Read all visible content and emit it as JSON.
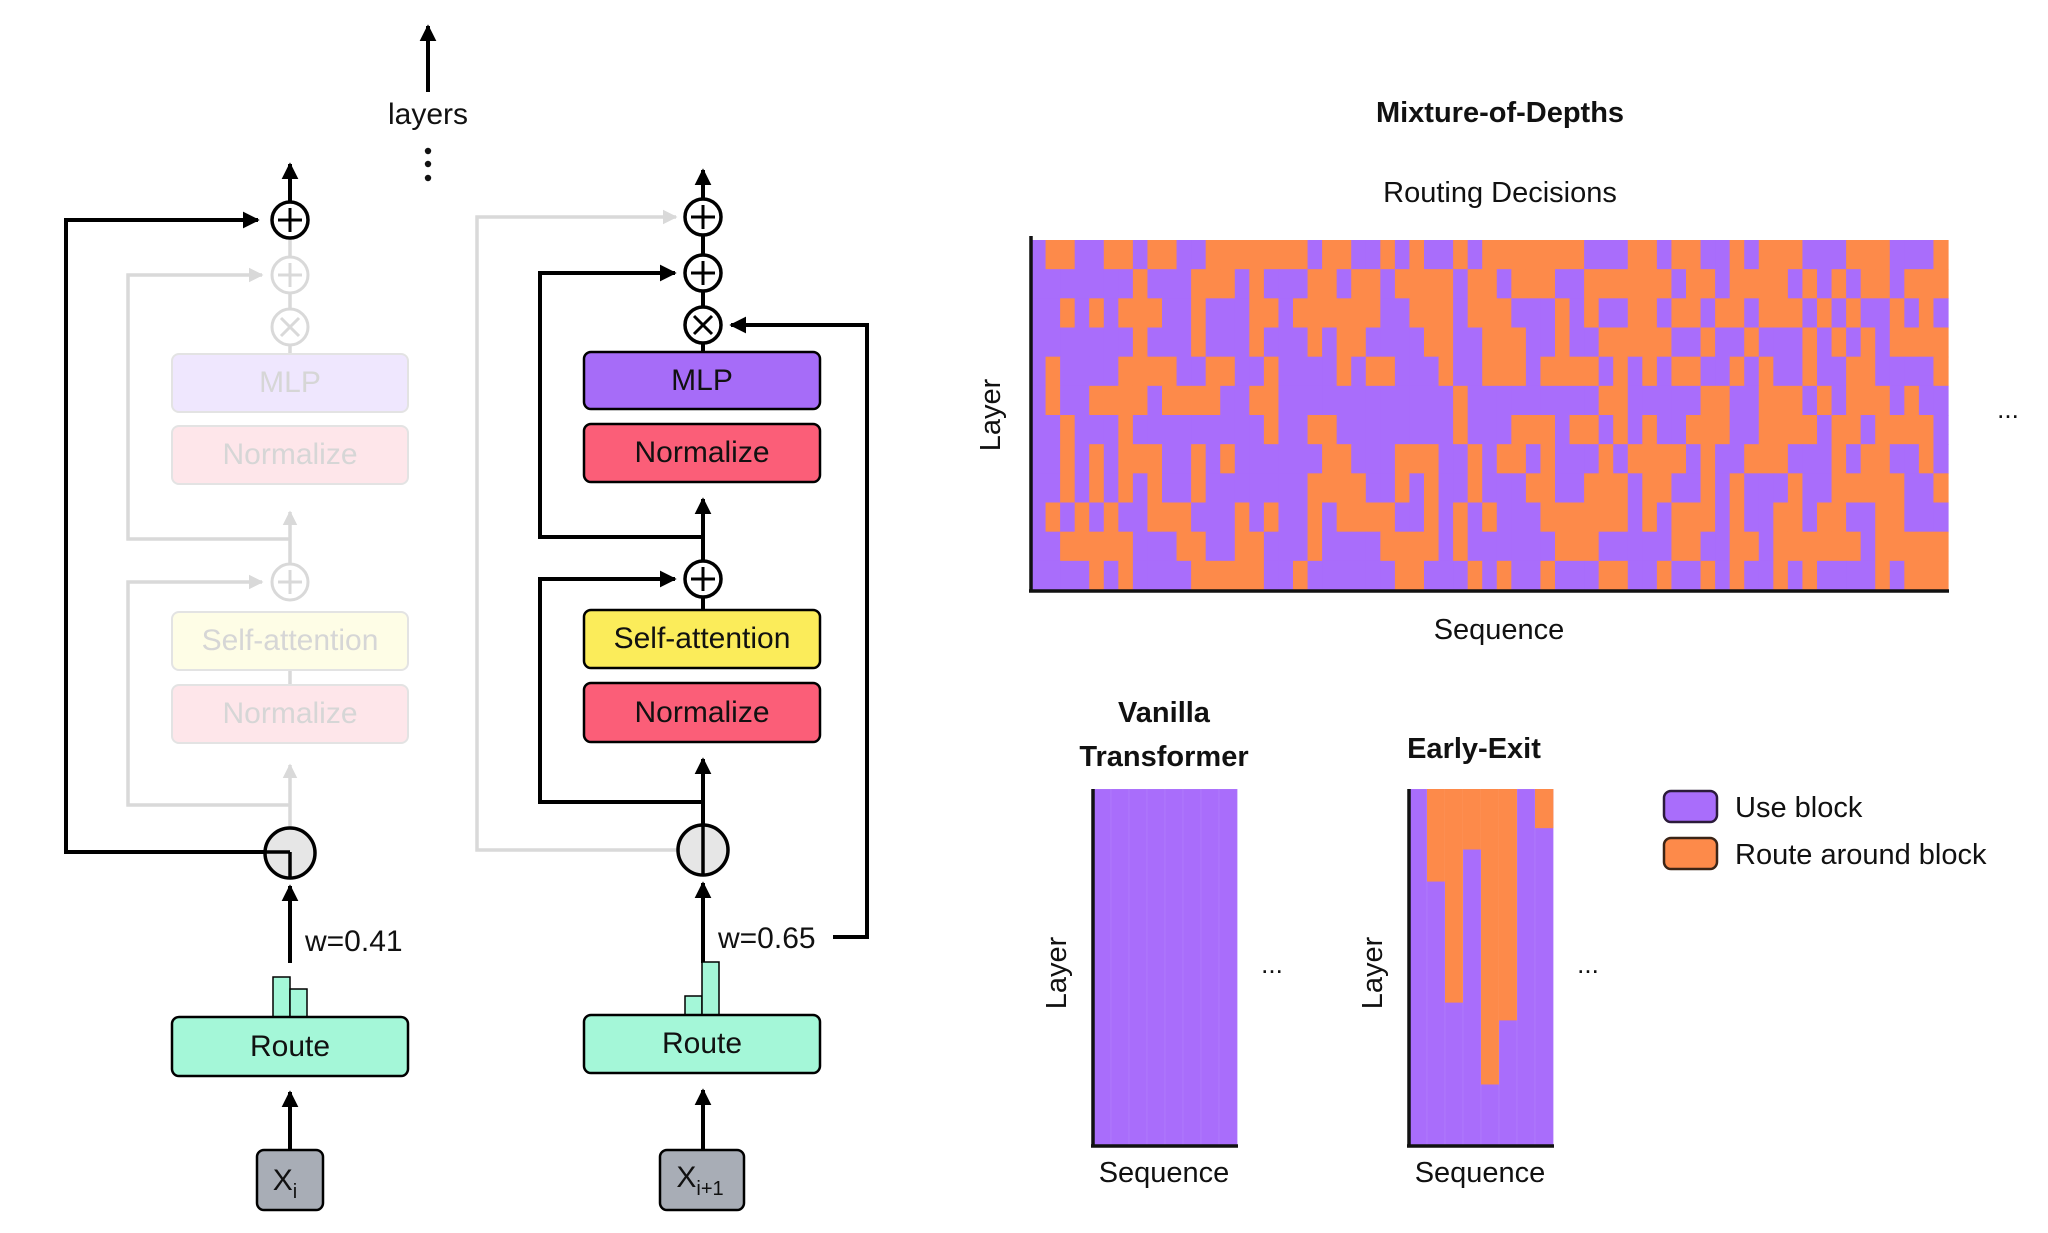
{
  "colors": {
    "use_block": "#a96dfb",
    "route_around": "#fd8a4a",
    "mlp": "#a66cf8",
    "normalize": "#fb5e78",
    "self_attention": "#fbec5a",
    "route": "#a4f7d8",
    "input": "#a8adb6",
    "faded_line": "#d9d9d9",
    "line": "#000000"
  },
  "left_diagram": {
    "layers_label": "layers",
    "ellipsis": "⋮",
    "block_skipped": {
      "mlp_label": "MLP",
      "normalize_top_label": "Normalize",
      "self_attention_label": "Self-attention",
      "normalize_bottom_label": "Normalize",
      "route_label": "Route",
      "weight_label": "w=0.41",
      "router_weight": 0.41,
      "input_label": "X",
      "input_subscript": "i",
      "routing_state": "skipped"
    },
    "block_used": {
      "mlp_label": "MLP",
      "normalize_top_label": "Normalize",
      "self_attention_label": "Self-attention",
      "normalize_bottom_label": "Normalize",
      "route_label": "Route",
      "weight_label": "w=0.65",
      "router_weight": 0.65,
      "input_label": "X",
      "input_subscript": "i+1",
      "routing_state": "used"
    },
    "plus_symbol": "+",
    "times_symbol": "×"
  },
  "chart_data": [
    {
      "type": "heatmap",
      "title": "Mixture-of-Depths",
      "subtitle": "Routing Decisions",
      "xlabel": "Sequence",
      "ylabel": "Layer",
      "continuation": "...",
      "legend_values": {
        "0": "Use block",
        "1": "Route around block"
      },
      "rows": [
        "011001101100111111101100101001011111110001101100101110001110001",
        "000000010001110100011011011110110111001111110110111101010110111",
        "001010111001000110111111001110111000101001101101101110101001010",
        "000000010001000100010110000110011100100111110010010001010101111",
        "010000111100110010000101100010011101111010101100101001001100001",
        "010011110111100110000000000001000000000110000011001110101110100",
        "001000100000000010011000000001000111011010100111001111011011110",
        "001010111001010000001100011100101101000101111010011100010110010",
        "001010101001000000011110010100100011001110110010100010011111001",
        "010101001110001010010111100101010001111110101110100110110011000",
        "001111100011001100010000111101000000111000001100110111111011111",
        "000010100001111100100000011000101001000110010010100101000010111"
      ]
    },
    {
      "type": "heatmap",
      "title": "Vanilla Transformer",
      "xlabel": "Sequence",
      "ylabel": "Layer",
      "continuation": "...",
      "columns_route_fraction": [
        0,
        0,
        0,
        0,
        0,
        0,
        0,
        0
      ]
    },
    {
      "type": "heatmap",
      "title": "Early-Exit",
      "xlabel": "Sequence",
      "ylabel": "Layer",
      "continuation": "...",
      "columns_route_fraction": [
        0,
        0.26,
        0.6,
        0.17,
        0.83,
        0.65,
        0,
        0.11
      ]
    }
  ],
  "main_chart": {
    "title": "Mixture-of-Depths",
    "subtitle": "Routing Decisions",
    "xlabel": "Sequence",
    "ylabel": "Layer",
    "ellipsis": "..."
  },
  "vanilla": {
    "title_line1": "Vanilla",
    "title_line2": "Transformer",
    "xlabel": "Sequence",
    "ylabel": "Layer",
    "ellipsis": "..."
  },
  "early_exit": {
    "title": "Early-Exit",
    "xlabel": "Sequence",
    "ylabel": "Layer",
    "ellipsis": "..."
  },
  "legend": {
    "items": [
      {
        "label": "Use block",
        "key": "use_block"
      },
      {
        "label": "Route around block",
        "key": "route_around"
      }
    ]
  }
}
